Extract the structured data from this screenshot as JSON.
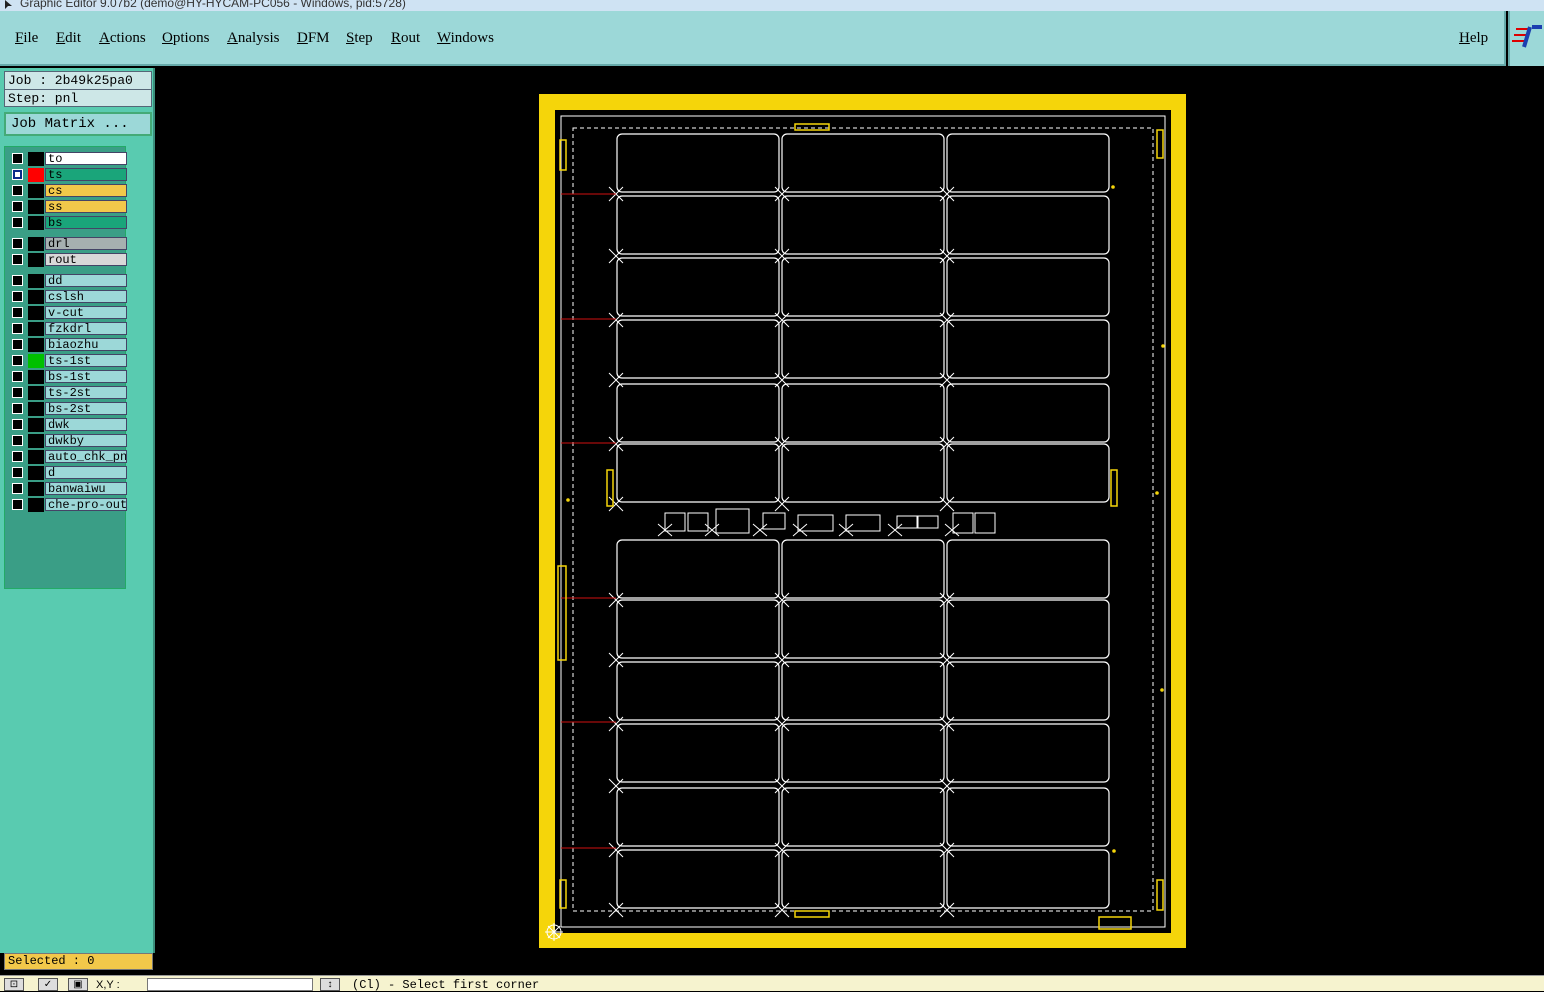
{
  "window": {
    "title": "Graphic Editor 9.07b2 (demo@HY-HYCAM-PC056 - Windows, pid:5728)"
  },
  "menu": {
    "items": [
      "File",
      "Edit",
      "Actions",
      "Options",
      "Analysis",
      "DFM",
      "Step",
      "Rout",
      "Windows"
    ],
    "help": "Help"
  },
  "job": {
    "job_line": "Job : 2b49k25pa0",
    "step_line": "Step: pnl"
  },
  "job_matrix_button": "Job Matrix ...",
  "layers": [
    {
      "name": "to",
      "color": "#ffffff",
      "swatch": "#000000",
      "checked": false
    },
    {
      "name": "ts",
      "color": "#1aa57a",
      "swatch": "#ff0000",
      "checked": true,
      "active": true
    },
    {
      "name": "cs",
      "color": "#f2c84a",
      "swatch": "#000000",
      "checked": false
    },
    {
      "name": "ss",
      "color": "#f2c84a",
      "swatch": "#000000",
      "checked": false
    },
    {
      "name": "bs",
      "color": "#1aa57a",
      "swatch": "#000000",
      "checked": false
    },
    {
      "name": "drl",
      "color": "#a6b0b0",
      "swatch": "#000000",
      "checked": false
    },
    {
      "name": "rout",
      "color": "#d8d8d8",
      "swatch": "#000000",
      "checked": false
    },
    {
      "name": "dd",
      "color": "#9cd8d8",
      "swatch": "#000000",
      "checked": false
    },
    {
      "name": "cslsh",
      "color": "#9cd8d8",
      "swatch": "#000000",
      "checked": false
    },
    {
      "name": "v-cut",
      "color": "#9cd8d8",
      "swatch": "#000000",
      "checked": false
    },
    {
      "name": "fzkdrl",
      "color": "#9cd8d8",
      "swatch": "#000000",
      "checked": false
    },
    {
      "name": "biaozhu",
      "color": "#9cd8d8",
      "swatch": "#000000",
      "checked": false
    },
    {
      "name": "ts-1st",
      "color": "#9cd8d8",
      "swatch": "#00c000",
      "checked": false
    },
    {
      "name": "bs-1st",
      "color": "#9cd8d8",
      "swatch": "#000000",
      "checked": false
    },
    {
      "name": "ts-2st",
      "color": "#9cd8d8",
      "swatch": "#000000",
      "checked": false
    },
    {
      "name": "bs-2st",
      "color": "#9cd8d8",
      "swatch": "#000000",
      "checked": false
    },
    {
      "name": "dwk",
      "color": "#9cd8d8",
      "swatch": "#000000",
      "checked": false
    },
    {
      "name": "dwkby",
      "color": "#9cd8d8",
      "swatch": "#000000",
      "checked": false
    },
    {
      "name": "auto_chk_pnl",
      "color": "#9cd8d8",
      "swatch": "#000000",
      "checked": false
    },
    {
      "name": "d",
      "color": "#9cd8d8",
      "swatch": "#000000",
      "checked": false
    },
    {
      "name": "banwaiwu",
      "color": "#9cd8d8",
      "swatch": "#000000",
      "checked": false
    },
    {
      "name": "che-pro-out",
      "color": "#9cd8d8",
      "swatch": "#000000",
      "checked": false
    }
  ],
  "selected_text": "Selected : 0",
  "status": {
    "xy_label": "X,Y :",
    "prompt": "(Cl) - Select first corner"
  },
  "colors": {
    "board_border": "#f5d50a",
    "profile": "#ffffff",
    "menu_bg": "#9cd8d8",
    "panel_bg": "#59cbb0"
  },
  "icons": [
    "gear-icon",
    "cursor-icon",
    "checkmark-icon",
    "window-icon",
    "logo-icon"
  ]
}
